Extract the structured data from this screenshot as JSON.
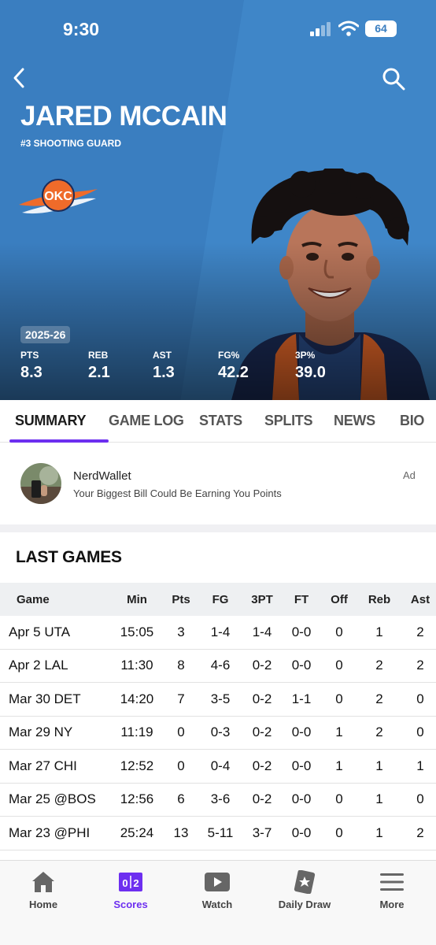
{
  "status_bar": {
    "time": "9:30",
    "battery": "64"
  },
  "player": {
    "name": "JARED MCCAIN",
    "subtitle": "#3 SHOOTING GUARD",
    "team_logo_text": "OKC",
    "season": "2025-26",
    "stats": [
      {
        "label": "PTS",
        "value": "8.3"
      },
      {
        "label": "REB",
        "value": "2.1"
      },
      {
        "label": "AST",
        "value": "1.3"
      },
      {
        "label": "FG%",
        "value": "42.2"
      },
      {
        "label": "3P%",
        "value": "39.0"
      }
    ]
  },
  "tabs": [
    {
      "label": "SUMMARY",
      "active": true
    },
    {
      "label": "GAME LOG"
    },
    {
      "label": "STATS"
    },
    {
      "label": "SPLITS"
    },
    {
      "label": "NEWS"
    },
    {
      "label": "BIO"
    }
  ],
  "ad": {
    "title": "NerdWallet",
    "text": "Your Biggest Bill Could Be Earning You Points",
    "tag": "Ad"
  },
  "last_games": {
    "title": "LAST GAMES",
    "columns": [
      "Game",
      "Min",
      "Pts",
      "FG",
      "3PT",
      "FT",
      "Off",
      "Reb",
      "Ast"
    ],
    "rows": [
      [
        "Apr 5 UTA",
        "15:05",
        "3",
        "1-4",
        "1-4",
        "0-0",
        "0",
        "1",
        "2"
      ],
      [
        "Apr 2 LAL",
        "11:30",
        "8",
        "4-6",
        "0-2",
        "0-0",
        "0",
        "2",
        "2"
      ],
      [
        "Mar 30 DET",
        "14:20",
        "7",
        "3-5",
        "0-2",
        "1-1",
        "0",
        "2",
        "0"
      ],
      [
        "Mar 29 NY",
        "11:19",
        "0",
        "0-3",
        "0-2",
        "0-0",
        "1",
        "2",
        "0"
      ],
      [
        "Mar 27 CHI",
        "12:52",
        "0",
        "0-4",
        "0-2",
        "0-0",
        "1",
        "1",
        "1"
      ],
      [
        "Mar 25 @BOS",
        "12:56",
        "6",
        "3-6",
        "0-2",
        "0-0",
        "0",
        "1",
        "0"
      ],
      [
        "Mar 23 @PHI",
        "25:24",
        "13",
        "5-11",
        "3-7",
        "0-0",
        "0",
        "1",
        "2"
      ]
    ]
  },
  "bottom_nav": [
    {
      "label": "Home",
      "icon": "home-icon"
    },
    {
      "label": "Scores",
      "icon": "scores-icon",
      "active": true
    },
    {
      "label": "Watch",
      "icon": "watch-icon"
    },
    {
      "label": "Daily Draw",
      "icon": "daily-draw-icon"
    },
    {
      "label": "More",
      "icon": "more-icon"
    }
  ],
  "colors": {
    "hero_blue": "#3f86c8",
    "accent_purple": "#6d2ff0",
    "okc_orange": "#ef6b2a"
  }
}
